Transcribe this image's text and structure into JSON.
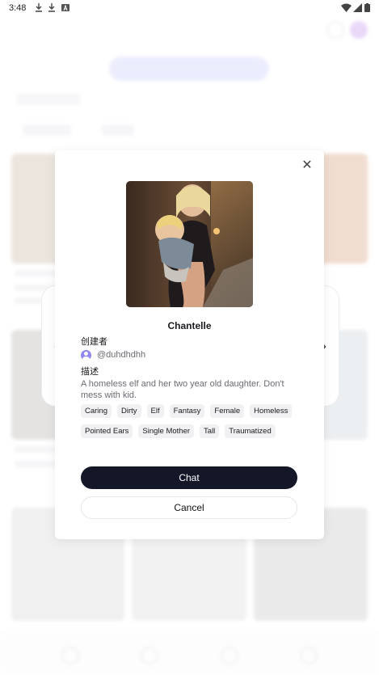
{
  "status_bar": {
    "time": "3:48",
    "left_icons": [
      "download-icon",
      "download-icon",
      "text-a-icon"
    ],
    "right_icons": [
      "wifi-icon",
      "signal-icon",
      "battery-icon"
    ]
  },
  "modal": {
    "character_name": "Chantelle",
    "creator_label": "创建者",
    "creator_handle": "@duhdhdhh",
    "description_label": "描述",
    "description": "A homeless elf and her two year old daughter. Don't mess with kid.",
    "tags": [
      "Caring",
      "Dirty",
      "Elf",
      "Fantasy",
      "Female",
      "Homeless",
      "Pointed Ears",
      "Single Mother",
      "Tall",
      "Traumatized"
    ],
    "chat_label": "Chat",
    "cancel_label": "Cancel"
  },
  "colors": {
    "primary_button": "#141728",
    "avatar_accent": "#8f86f0",
    "tag_bg": "#f1f1f3"
  }
}
